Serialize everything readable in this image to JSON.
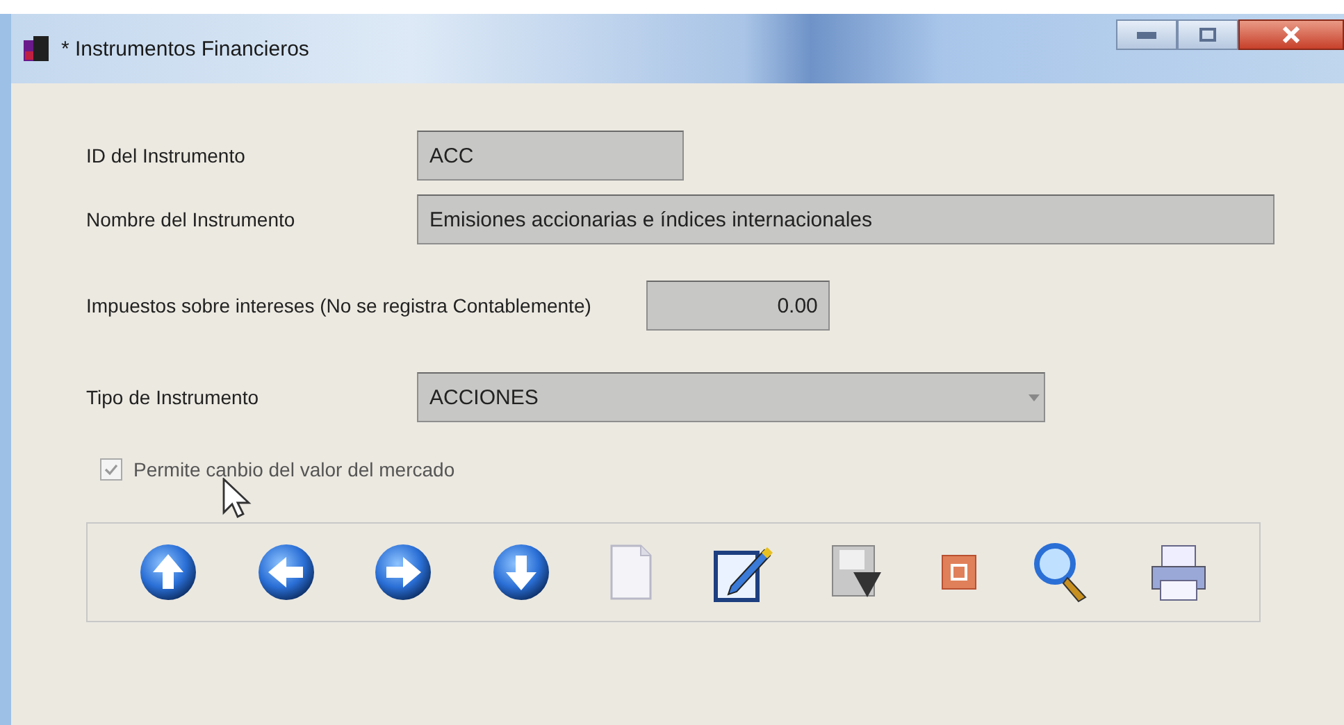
{
  "window": {
    "title": "* Instrumentos Financieros"
  },
  "fields": [
    {
      "label": "ID del Instrumento",
      "kind": "text",
      "value": "ACC",
      "disabled": true
    },
    {
      "label": "Nombre del Instrumento",
      "kind": "text",
      "value": "Emisiones accionarias e índices internacionales",
      "disabled": true
    },
    {
      "label": "Impuestos sobre intereses (No se registra Contablemente)",
      "kind": "number",
      "value": "0.00",
      "disabled": true
    },
    {
      "label": "Tipo de Instrumento",
      "kind": "dropdown",
      "value": "ACCIONES",
      "disabled": true
    }
  ],
  "checkbox": {
    "label": "Permite canbio del valor del  mercado",
    "checked": true,
    "disabled": true
  },
  "toolbar": [
    {
      "kind": "first"
    },
    {
      "kind": "previous"
    },
    {
      "kind": "next"
    },
    {
      "kind": "last"
    },
    {
      "kind": "new"
    },
    {
      "kind": "edit"
    },
    {
      "kind": "save"
    },
    {
      "kind": "cancel"
    },
    {
      "kind": "search"
    },
    {
      "kind": "print"
    }
  ]
}
